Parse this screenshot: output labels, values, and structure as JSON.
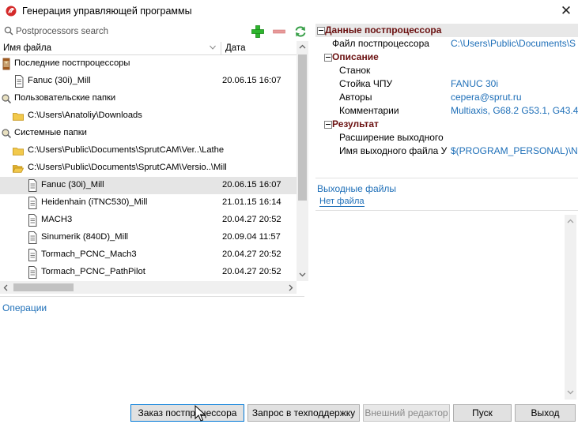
{
  "window": {
    "title": "Генерация управляющей программы",
    "close": "✕"
  },
  "search": {
    "placeholder": "Postprocessors search"
  },
  "list": {
    "col_name": "Имя файла",
    "col_date": "Дата",
    "rows": [
      {
        "label": "Последние постпроцессоры",
        "date": ""
      },
      {
        "label": "Fanuc (30i)_Mill",
        "date": "20.06.15 16:07"
      },
      {
        "label": "Пользовательские папки",
        "date": ""
      },
      {
        "label": "C:\\Users\\Anatoliy\\Downloads",
        "date": ""
      },
      {
        "label": "Системные папки",
        "date": ""
      },
      {
        "label": "C:\\Users\\Public\\Documents\\SprutCAM\\Ver..\\Lathe",
        "date": ""
      },
      {
        "label": "C:\\Users\\Public\\Documents\\SprutCAM\\Versio..\\Mill",
        "date": ""
      },
      {
        "label": "Fanuc (30i)_Mill",
        "date": "20.06.15 16:07"
      },
      {
        "label": "Heidenhain (iTNC530)_Mill",
        "date": "21.01.15 16:14"
      },
      {
        "label": "MACH3",
        "date": "20.04.27 20:52"
      },
      {
        "label": "Sinumerik (840D)_Mill",
        "date": "20.09.04 11:57"
      },
      {
        "label": "Tormach_PCNC_Mach3",
        "date": "20.04.27 20:52"
      },
      {
        "label": "Tormach_PCNC_PathPilot",
        "date": "20.04.27 20:52"
      }
    ]
  },
  "operations_link": "Операции",
  "props": {
    "section_data": "Данные постпроцессора",
    "file_label": "Файл постпроцессора",
    "file_value": "C:\\Users\\Public\\Documents\\S",
    "section_desc": "Описание",
    "machine_label": "Станок",
    "machine_value": "",
    "cnc_label": "Стойка ЧПУ",
    "cnc_value": "FANUC 30i",
    "authors_label": "Авторы",
    "authors_value": "cepera@sprut.ru",
    "comments_label": "Комментарии",
    "comments_value": "Multiaxis, G68.2 G53.1, G43.4",
    "section_result": "Результат",
    "ext_label": "Расширение выходного",
    "ext_value": "",
    "outname_label": "Имя выходного файла У",
    "outname_value": "$(PROGRAM_PERSONAL)\\N"
  },
  "output": {
    "title": "Выходные файлы",
    "no_file": "Нет файла"
  },
  "buttons": {
    "order": "Заказ постпроцессора",
    "support": "Запрос в техподдержку",
    "editor": "Внешний редактор",
    "run": "Пуск",
    "exit": "Выход"
  },
  "colors": {
    "link": "#1e6fb8",
    "section": "#6a1010",
    "add": "#2db52d",
    "remove": "#e07a7a",
    "refresh": "#3aa04a"
  }
}
